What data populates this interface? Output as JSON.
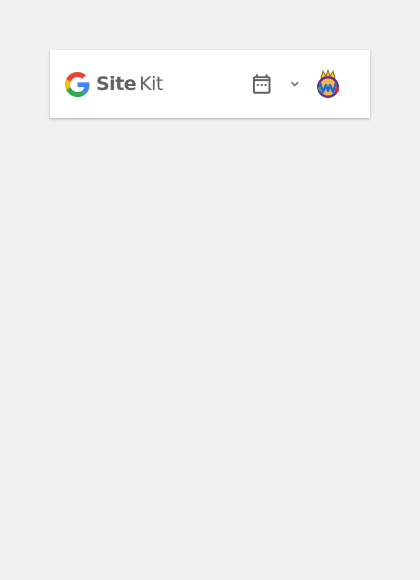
{
  "header": {
    "logo": {
      "brand_mark": "google-g-logo",
      "name_part1": "Site",
      "name_part2": "Kit"
    },
    "date_range": {
      "icon": "calendar-icon",
      "dropdown_icon": "chevron-down-icon"
    },
    "account": {
      "icon": "avatar"
    }
  },
  "colors": {
    "page_background": "#f1f1f1",
    "card_background": "#ffffff",
    "logo_text": "#5f6368",
    "icon": "#5f6368",
    "google_blue": "#4285F4",
    "google_red": "#EA4335",
    "google_yellow": "#FBBC05",
    "google_green": "#34A853"
  }
}
